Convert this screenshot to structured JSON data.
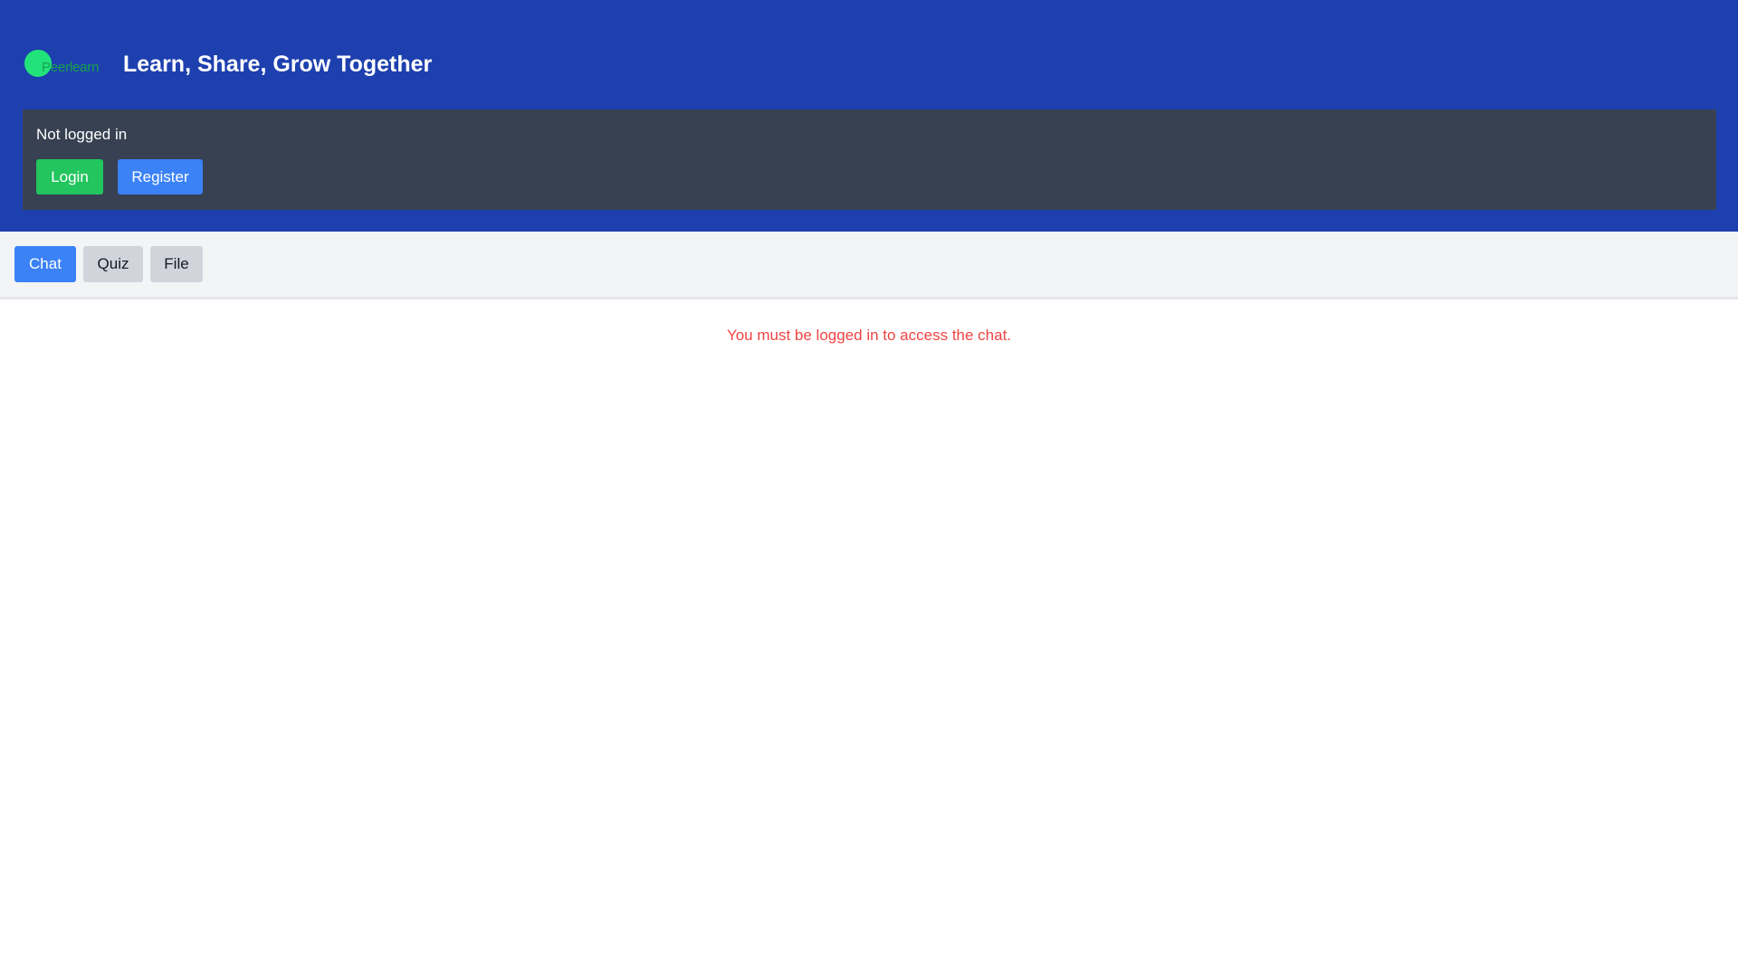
{
  "header": {
    "logo_text": "Peerlearn",
    "tagline": "Learn, Share, Grow Together",
    "brand_color": "#1e40af"
  },
  "auth": {
    "status": "Not logged in",
    "login_label": "Login",
    "register_label": "Register"
  },
  "tabs": [
    {
      "label": "Chat",
      "active": true
    },
    {
      "label": "Quiz",
      "active": false
    },
    {
      "label": "File",
      "active": false
    }
  ],
  "main": {
    "message": "You must be logged in to access the chat.",
    "message_color": "#ef4444"
  }
}
